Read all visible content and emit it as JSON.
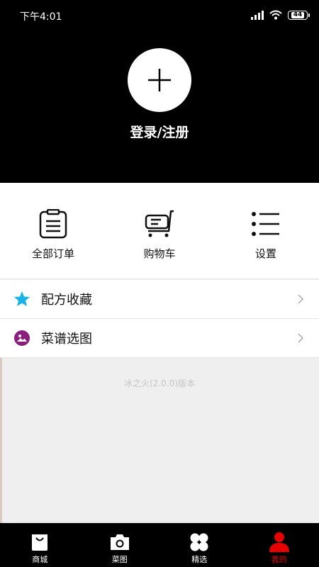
{
  "status_bar": {
    "time": "下午4:01",
    "battery": "44"
  },
  "header": {
    "login_label": "登录/注册"
  },
  "quick_actions": [
    {
      "label": "全部订单",
      "icon": "clipboard-icon"
    },
    {
      "label": "购物车",
      "icon": "shopping-cart-icon"
    },
    {
      "label": "设置",
      "icon": "list-settings-icon"
    }
  ],
  "menu": [
    {
      "label": "配方收藏",
      "icon": "star-icon",
      "icon_color": "#1ab3e8"
    },
    {
      "label": "菜谱选图",
      "icon": "picture-icon",
      "icon_color": "#8a1f7e"
    }
  ],
  "version": "冰之火(2.0.0)版本",
  "bottom_nav": [
    {
      "label": "商城",
      "icon": "bag-icon"
    },
    {
      "label": "菜图",
      "icon": "camera-icon"
    },
    {
      "label": "精选",
      "icon": "clover-icon"
    },
    {
      "label": "我的",
      "icon": "user-icon",
      "active": true
    }
  ],
  "colors": {
    "header_bg": "#000000",
    "active": "#e60000",
    "star": "#1ab3e8",
    "picture": "#8a1f7e"
  }
}
